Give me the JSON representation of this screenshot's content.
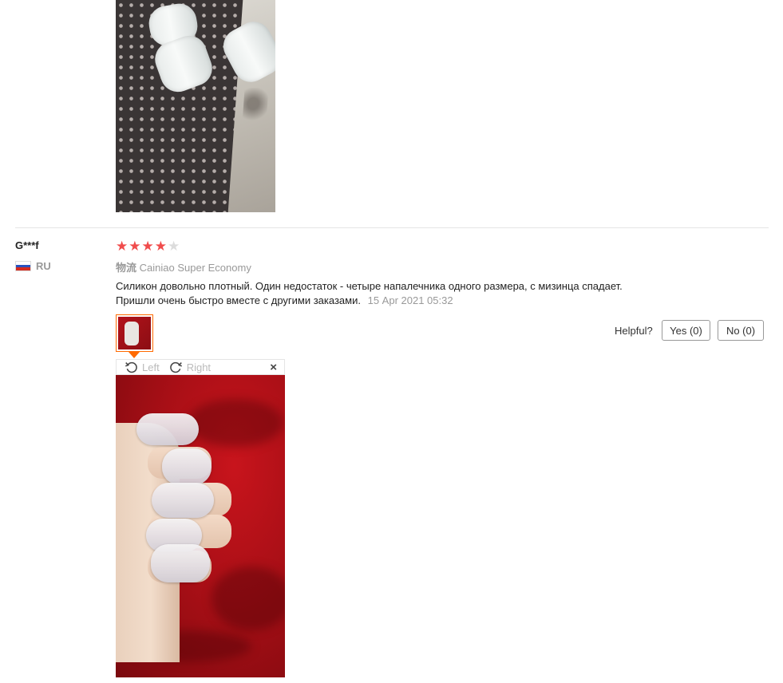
{
  "review": {
    "user_name": "G***f",
    "country_code": "RU",
    "rating": 4,
    "rating_max": 5,
    "logistics_label": "物流",
    "logistics_value": "Cainiao Super Economy",
    "text_line1": "Силикон довольно плотный. Один недостаток - четыре напалечника одного размера, с мизинца спадает.",
    "text_line2": "Пришли очень быстро вместе с другими заказами.",
    "date": "15 Apr 2021 05:32",
    "helpful_label": "Helpful?",
    "yes_label": "Yes (0)",
    "no_label": "No (0)"
  },
  "viewer": {
    "rotate_left_label": "Left",
    "rotate_right_label": "Right",
    "close_symbol": "×",
    "rotate_left_icon": "rotate-left-icon",
    "rotate_right_icon": "rotate-right-icon"
  },
  "colors": {
    "star_on": "#f04c4c",
    "star_off": "#dcdcdc",
    "thumb_border": "#ff6a00"
  }
}
